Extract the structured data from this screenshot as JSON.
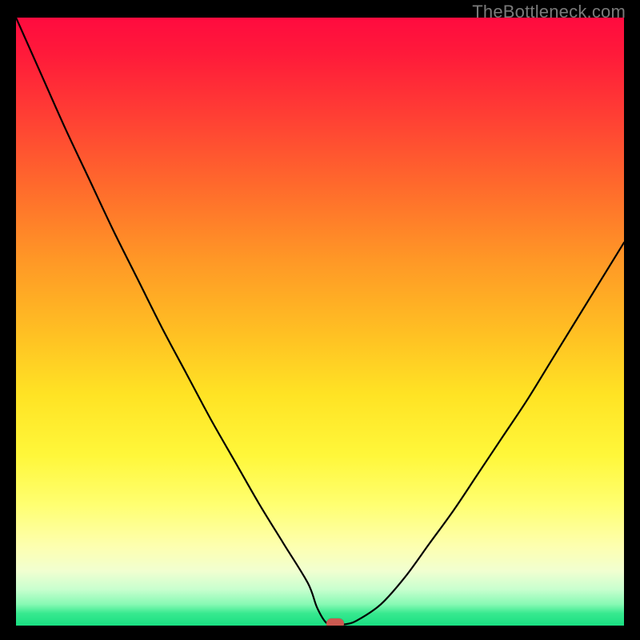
{
  "watermark": "TheBottleneck.com",
  "chart_data": {
    "type": "line",
    "title": "",
    "xlabel": "",
    "ylabel": "",
    "x": [
      0.0,
      0.04,
      0.08,
      0.12,
      0.16,
      0.2,
      0.24,
      0.28,
      0.32,
      0.36,
      0.4,
      0.44,
      0.48,
      0.495,
      0.51,
      0.525,
      0.54,
      0.56,
      0.6,
      0.64,
      0.68,
      0.72,
      0.76,
      0.8,
      0.84,
      0.88,
      0.92,
      0.96,
      1.0
    ],
    "values": [
      100.0,
      91.0,
      82.0,
      73.5,
      65.0,
      57.0,
      49.0,
      41.5,
      34.0,
      27.0,
      20.0,
      13.5,
      7.0,
      3.0,
      0.5,
      0.2,
      0.2,
      0.8,
      3.5,
      8.0,
      13.5,
      19.0,
      25.0,
      31.0,
      37.0,
      43.5,
      50.0,
      56.5,
      63.0
    ],
    "xlim": [
      0,
      1
    ],
    "ylim": [
      0,
      100
    ],
    "grid": false,
    "legend": false,
    "marker": {
      "x": 0.525,
      "y": 0.4
    },
    "background": "vertical-heatmap-gradient",
    "gradient_stops": [
      {
        "pos": 0.0,
        "color": "#ff0b3f"
      },
      {
        "pos": 0.4,
        "color": "#ff9826"
      },
      {
        "pos": 0.72,
        "color": "#fff73a"
      },
      {
        "pos": 0.94,
        "color": "#c9ffcf"
      },
      {
        "pos": 1.0,
        "color": "#19df82"
      }
    ]
  }
}
